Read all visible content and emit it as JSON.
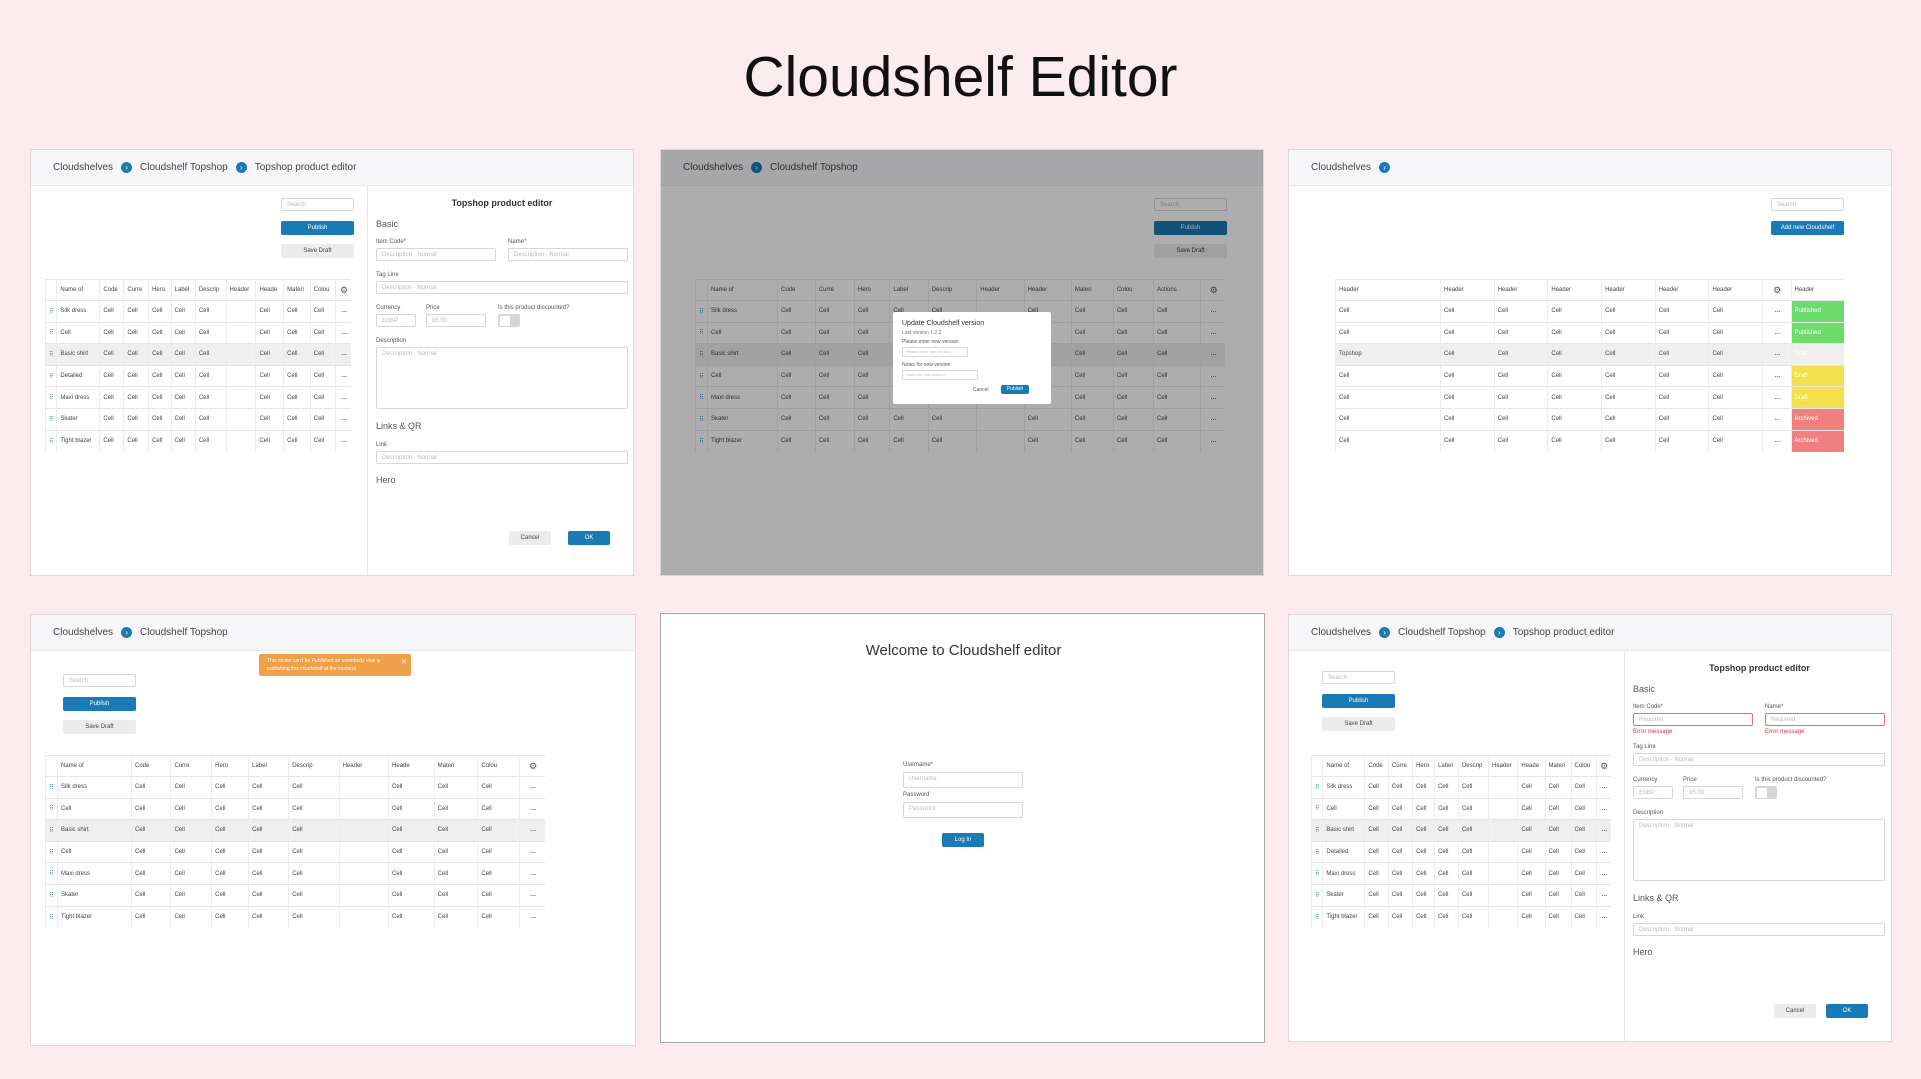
{
  "page": {
    "title": "Cloudshelf Editor"
  },
  "common": {
    "search_placeholder": "Search",
    "publish": "Publish",
    "save_draft": "Save Draft",
    "cell": "Cell",
    "dots": "···",
    "drag": "⠿",
    "gear": "⚙",
    "crumb_sep": "›"
  },
  "table": {
    "headers": [
      "Name of",
      "Code",
      "Curre",
      "Hero",
      "Label",
      "Descrip",
      "Header",
      "Heade",
      "Materi",
      "Colou"
    ],
    "rows": [
      "Silk dress",
      "Cell",
      "Basic shirt",
      "Detailed",
      "Maxi dress",
      "Skater",
      "Tight blazer"
    ]
  },
  "panel1": {
    "breadcrumb": [
      "Cloudshelves",
      "Cloudshelf Topshop",
      "Topshop product editor"
    ],
    "row_names": [
      "Silk dress",
      "Cell",
      "Basic shirt",
      "Detailed",
      "Maxi dress",
      "Skater",
      "Tight blazer"
    ]
  },
  "editor": {
    "title": "Topshop product editor",
    "basic": "Basic",
    "item_code_label": "Item Code*",
    "name_label": "Name*",
    "normal_placeholder": "Description - Normal",
    "tagline_label": "Tag Line",
    "currency_label": "Currency",
    "currency_value": "£GBP",
    "price_label": "Price",
    "price_value": "85.00",
    "discount_label": "Is this product discounted?",
    "description_label": "Description",
    "links_qr": "Links & QR",
    "link_label": "Link",
    "hero": "Hero",
    "cancel": "Cancel",
    "ok": "OK",
    "required_placeholder": "Required",
    "error_message": "Error message"
  },
  "panel2": {
    "breadcrumb": [
      "Cloudshelves",
      "Cloudshelf Topshop"
    ],
    "headers": [
      "Name of",
      "Code",
      "Curre",
      "Hero",
      "Label",
      "Descrip",
      "Header",
      "Header",
      "Materi",
      "Colou",
      "Actions"
    ],
    "row_names": [
      "Silk dress",
      "Cell",
      "Basic shirt",
      "Cell",
      "Maxi dress",
      "Skater",
      "Tight blazer"
    ],
    "modal": {
      "title": "Update Cloudshelf version",
      "subtitle": "Last version 1.2.2",
      "version_label": "Please enter new version:",
      "version_placeholder": "Please enter new version",
      "notes_label": "Notes for new version:",
      "notes_placeholder": "Notes for new version",
      "cancel": "Cancel",
      "publish": "Publish"
    }
  },
  "panel3": {
    "breadcrumb": [
      "Cloudshelves"
    ],
    "add_button": "Add new Cloudshelf",
    "header": "Header",
    "first_col": [
      "Cell",
      "Cell",
      "Topshop",
      "Cell",
      "Cell",
      "Cell",
      "Cell"
    ],
    "statuses": [
      "Published",
      "Published",
      "Draft",
      "Draft",
      "Draft",
      "Archived",
      "Archived"
    ],
    "colors": {
      "published": "#6ddc6d",
      "draft": "#f2e04d",
      "archived": "#f08080"
    }
  },
  "panel4": {
    "breadcrumb": [
      "Cloudshelves",
      "Cloudshelf Topshop"
    ],
    "toast": "This model can't be Published as somebody else is publishing this cloudshelf at the moment",
    "toast_close": "✕",
    "row_names": [
      "Silk dress",
      "Cell",
      "Basic shirt",
      "Cell",
      "Maxi dress",
      "Skater",
      "Tight blazer"
    ]
  },
  "panel5": {
    "welcome": "Welcome to Cloudshelf editor",
    "username_label": "Username*",
    "username_placeholder": "Username",
    "password_label": "Password",
    "password_placeholder": "Password",
    "login": "Log In"
  },
  "panel6": {
    "breadcrumb": [
      "Cloudshelves",
      "Cloudshelf Topshop",
      "Topshop product editor"
    ],
    "row_names": [
      "Silk dress",
      "Cell",
      "Basic shirt",
      "Detailed",
      "Maxi dress",
      "Skater",
      "Tight blazer"
    ]
  }
}
